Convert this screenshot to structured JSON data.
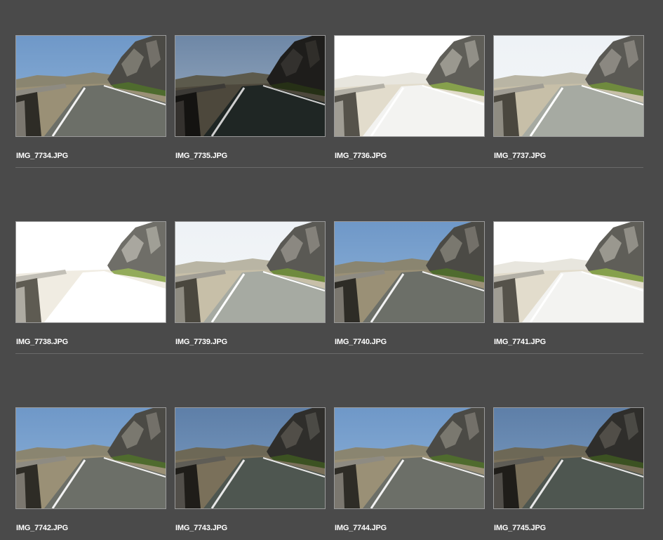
{
  "rows": [
    {
      "items": [
        {
          "filename": "IMG_7734.JPG",
          "variant": "normal"
        },
        {
          "filename": "IMG_7735.JPG",
          "variant": "dark"
        },
        {
          "filename": "IMG_7736.JPG",
          "variant": "bright"
        },
        {
          "filename": "IMG_7737.JPG",
          "variant": "light"
        }
      ]
    },
    {
      "items": [
        {
          "filename": "IMG_7738.JPG",
          "variant": "white"
        },
        {
          "filename": "IMG_7739.JPG",
          "variant": "light"
        },
        {
          "filename": "IMG_7740.JPG",
          "variant": "normal"
        },
        {
          "filename": "IMG_7741.JPG",
          "variant": "bright"
        }
      ]
    },
    {
      "items": [
        {
          "filename": "IMG_7742.JPG",
          "variant": "normal"
        },
        {
          "filename": "IMG_7743.JPG",
          "variant": "mid"
        },
        {
          "filename": "IMG_7744.JPG",
          "variant": "normal"
        },
        {
          "filename": "IMG_7745.JPG",
          "variant": "mid"
        }
      ]
    }
  ],
  "colors": {
    "background": "#4a4a4a",
    "thumb_border": "#9a9a9a",
    "divider": "#6a6a6a",
    "filename_text": "#ffffff"
  }
}
